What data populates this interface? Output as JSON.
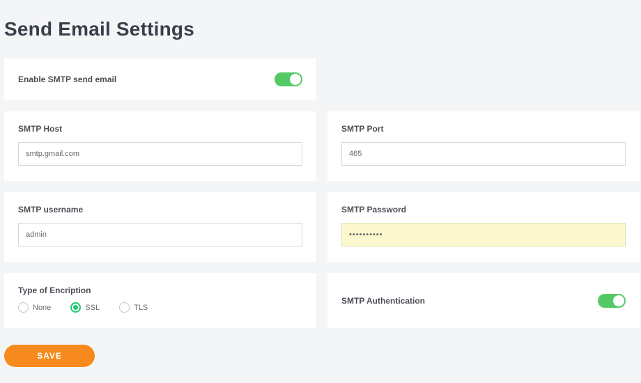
{
  "page": {
    "title": "Send Email Settings"
  },
  "enable_smtp": {
    "label": "Enable SMTP send email",
    "on": true
  },
  "smtp_host": {
    "label": "SMTP Host",
    "value": "smtp.gmail.com"
  },
  "smtp_port": {
    "label": "SMTP Port",
    "value": "465"
  },
  "smtp_user": {
    "label": "SMTP username",
    "value": "admin"
  },
  "smtp_pass": {
    "label": "SMTP Password",
    "value": "••••••••••"
  },
  "encryption": {
    "label": "Type of Encription",
    "options": {
      "none": "None",
      "ssl": "SSL",
      "tls": "TLS"
    },
    "selected": "ssl"
  },
  "smtp_auth": {
    "label": "SMTP Authentication",
    "on": true
  },
  "actions": {
    "save": "SAVE"
  }
}
